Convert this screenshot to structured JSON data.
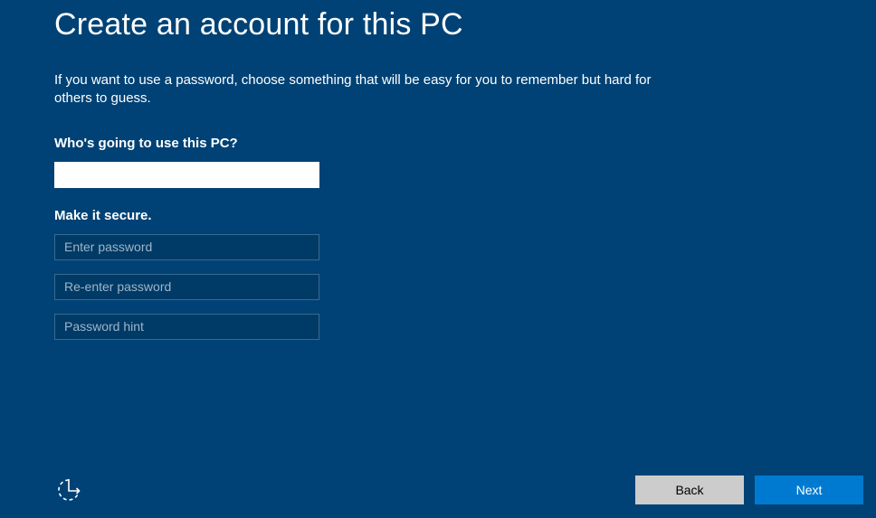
{
  "title": "Create an account for this PC",
  "description": "If you want to use a password, choose something that will be easy for you to remember but hard for others to guess.",
  "username_section": {
    "label": "Who's going to use this PC?",
    "username_value": ""
  },
  "password_section": {
    "label": "Make it secure.",
    "password_placeholder": "Enter password",
    "confirm_placeholder": "Re-enter password",
    "hint_placeholder": "Password hint"
  },
  "buttons": {
    "back_label": "Back",
    "next_label": "Next"
  },
  "icons": {
    "ease_of_access": "ease-of-access-icon"
  }
}
